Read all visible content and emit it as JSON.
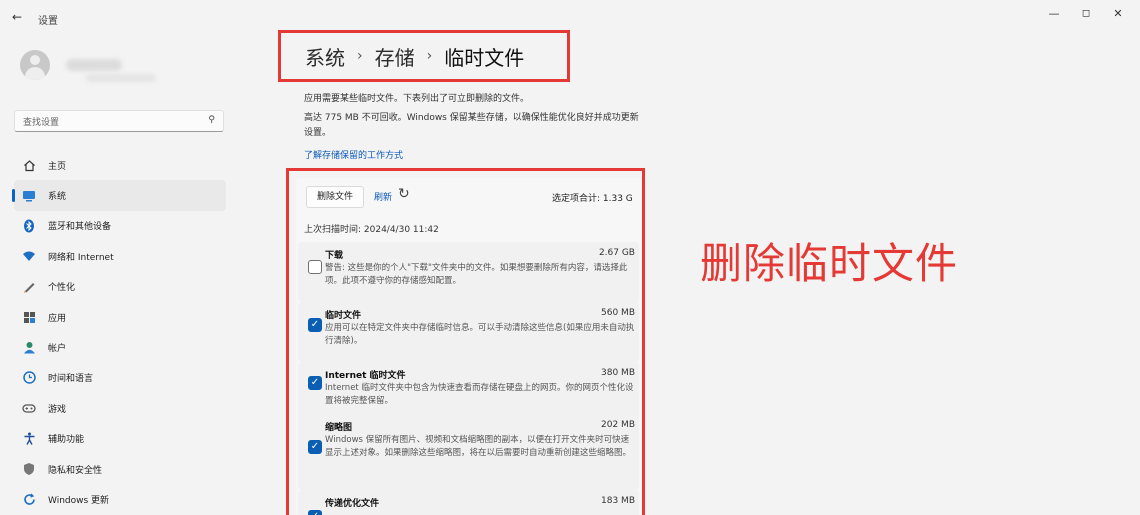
{
  "window": {
    "back_icon": "back-arrow-icon",
    "title": "设置",
    "min_glyph": "—",
    "max_glyph": "◻",
    "close_glyph": "✕"
  },
  "sidebar": {
    "search_placeholder": "查找设置",
    "items": [
      {
        "label": "主页",
        "icon": "home-icon"
      },
      {
        "label": "系统",
        "icon": "system-icon",
        "active": true
      },
      {
        "label": "蓝牙和其他设备",
        "icon": "bluetooth-icon"
      },
      {
        "label": "网络和 Internet",
        "icon": "wifi-icon"
      },
      {
        "label": "个性化",
        "icon": "pen-icon"
      },
      {
        "label": "应用",
        "icon": "apps-icon"
      },
      {
        "label": "帐户",
        "icon": "person-icon"
      },
      {
        "label": "时间和语言",
        "icon": "globe-clock-icon"
      },
      {
        "label": "游戏",
        "icon": "gamepad-icon"
      },
      {
        "label": "辅助功能",
        "icon": "accessibility-icon"
      },
      {
        "label": "隐私和安全性",
        "icon": "shield-icon"
      },
      {
        "label": "Windows 更新",
        "icon": "update-icon"
      }
    ]
  },
  "breadcrumb": {
    "items": [
      "系统",
      "存储",
      "临时文件"
    ],
    "separator": "›"
  },
  "main": {
    "intro": "应用需要某些临时文件。下表列出了可立即删除的文件。",
    "reserved": "高达 775 MB 不可回收。Windows 保留某些存储，以确保性能优化良好并成功更新设置。",
    "link": "了解存储保留的工作方式",
    "delete_button": "删除文件",
    "refresh_label": "刷新",
    "refresh_icon": "refresh-icon",
    "selected_total": "选定项合计: 1.33 G",
    "last_scan": "上次扫描时间: 2024/4/30 11:42",
    "items": [
      {
        "name": "下载",
        "size": "2.67 GB",
        "checked": false,
        "desc": "警告: 这些是你的个人\"下载\"文件夹中的文件。如果想要删除所有内容，请选择此项。此项不遵守你的存储感知配置。"
      },
      {
        "name": "临时文件",
        "size": "560 MB",
        "checked": true,
        "desc": "应用可以在特定文件夹中存储临时信息。可以手动清除这些信息(如果应用未自动执行清除)。"
      },
      {
        "name": "Internet 临时文件",
        "size": "380 MB",
        "checked": true,
        "desc": "Internet 临时文件夹中包含为快速查看而存储在硬盘上的网页。你的网页个性化设置将被完整保留。"
      },
      {
        "name": "缩略图",
        "size": "202 MB",
        "checked": true,
        "desc": "Windows 保留所有图片、视频和文档缩略图的副本，以便在打开文件夹时可快速显示上述对象。如果删除这些缩略图，将在以后需要时自动重新创建这些缩略图。"
      },
      {
        "name": "传递优化文件",
        "size": "183 MB",
        "checked": true,
        "desc": ""
      }
    ]
  },
  "annotation": "删除临时文件",
  "colors": {
    "accent": "#0a5fb4",
    "highlight": "#e53935"
  }
}
